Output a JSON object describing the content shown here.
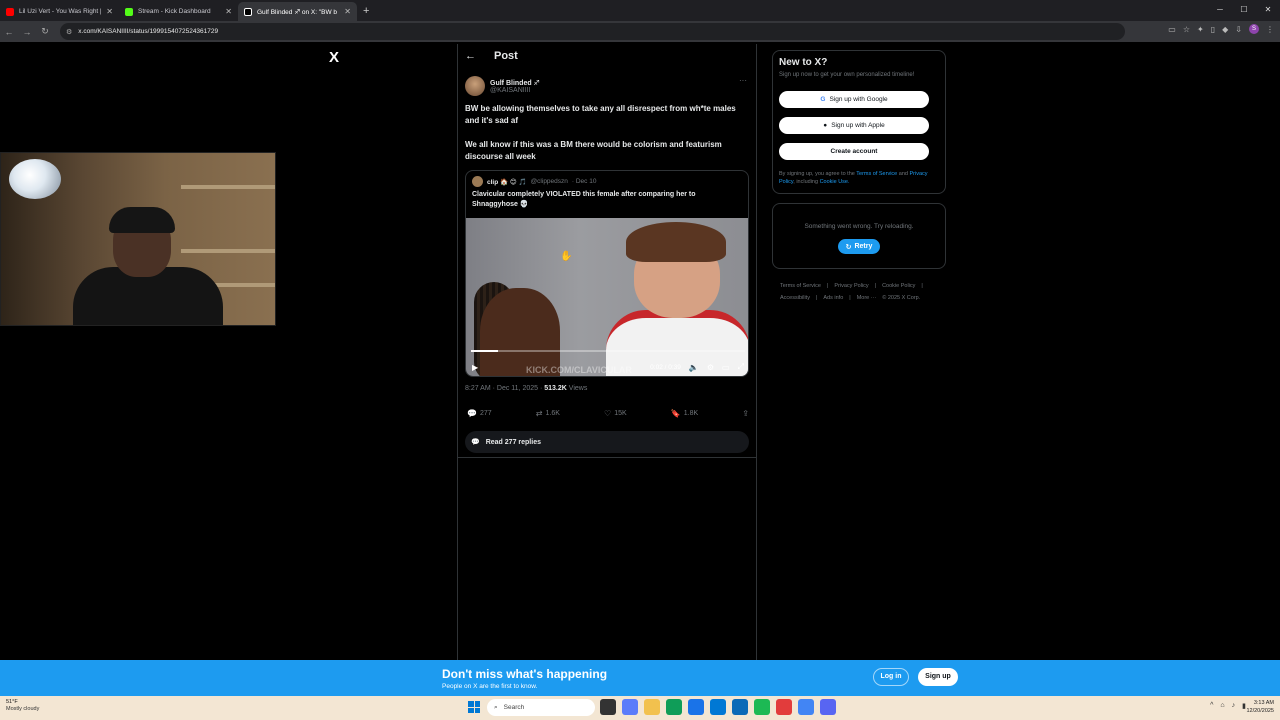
{
  "browser": {
    "tabs": [
      {
        "label": "Lil Uzi Vert - You Was Right [Of",
        "color": "#ff0000",
        "active": false
      },
      {
        "label": "Stream - Kick Dashboard",
        "color": "#53fc18",
        "active": false
      },
      {
        "label": "Gulf Blinded ♐ on X: \"BW b",
        "color": "#ffffff",
        "active": true
      }
    ],
    "url": "x.com/KAISANIIII/status/1999154072524361729"
  },
  "x": {
    "logo": "X",
    "post_title": "Post",
    "author": {
      "display_name": "Gulf Blinded ♐",
      "handle": "@KAISANIIII"
    },
    "tweet_paragraphs": [
      "BW be allowing themselves to take any all disrespect from wh*te males and it's sad af",
      "We all know if this was a BM there would be colorism and featurism discourse all week"
    ],
    "quote": {
      "name": "clip 🏠 😊 🎵",
      "handle": "@clippedszn",
      "date": "· Dec 10",
      "text": "Clavicular completely VIOLATED this female after comparing her to Shnaggyhose 💀",
      "video_time": "0:02 / 0:39",
      "video_progress": 0.1,
      "watermark": "KICK.COM/CLAVICULAR"
    },
    "timestamp": "8:27 AM · Dec 11, 2025 · ",
    "views_count": "513.2K",
    "views_label": " Views",
    "actions": {
      "replies": "277",
      "reposts": "1.6K",
      "likes": "15K",
      "bookmarks": "1.8K"
    },
    "read_replies": "Read 277 replies"
  },
  "sidebar": {
    "title": "New to X?",
    "subtitle": "Sign up now to get your own personalized timeline!",
    "google_btn": "Sign up with Google",
    "apple_btn": "Sign up with Apple",
    "create_btn": "Create account",
    "terms_prefix": "By signing up, you agree to the ",
    "terms_link": "Terms of Service",
    "terms_and": " and ",
    "privacy_link": "Privacy Policy",
    "terms_including": ", including ",
    "cookie_link": "Cookie Use.",
    "error_msg": "Something went wrong. Try reloading.",
    "retry": "Retry",
    "footer": [
      "Terms of Service",
      "|",
      "Privacy Policy",
      "|",
      "Cookie Policy",
      "|",
      "Accessibility",
      "|",
      "Ads info",
      "|",
      "More ···",
      "© 2025 X Corp."
    ]
  },
  "banner": {
    "title": "Don't miss what's happening",
    "subtitle": "People on X are the first to know.",
    "login": "Log in",
    "signup": "Sign up"
  },
  "taskbar": {
    "temp": "51°F",
    "weather": "Mostly cloudy",
    "search": "Search",
    "time": "3:13 AM",
    "date": "12/20/2025"
  }
}
